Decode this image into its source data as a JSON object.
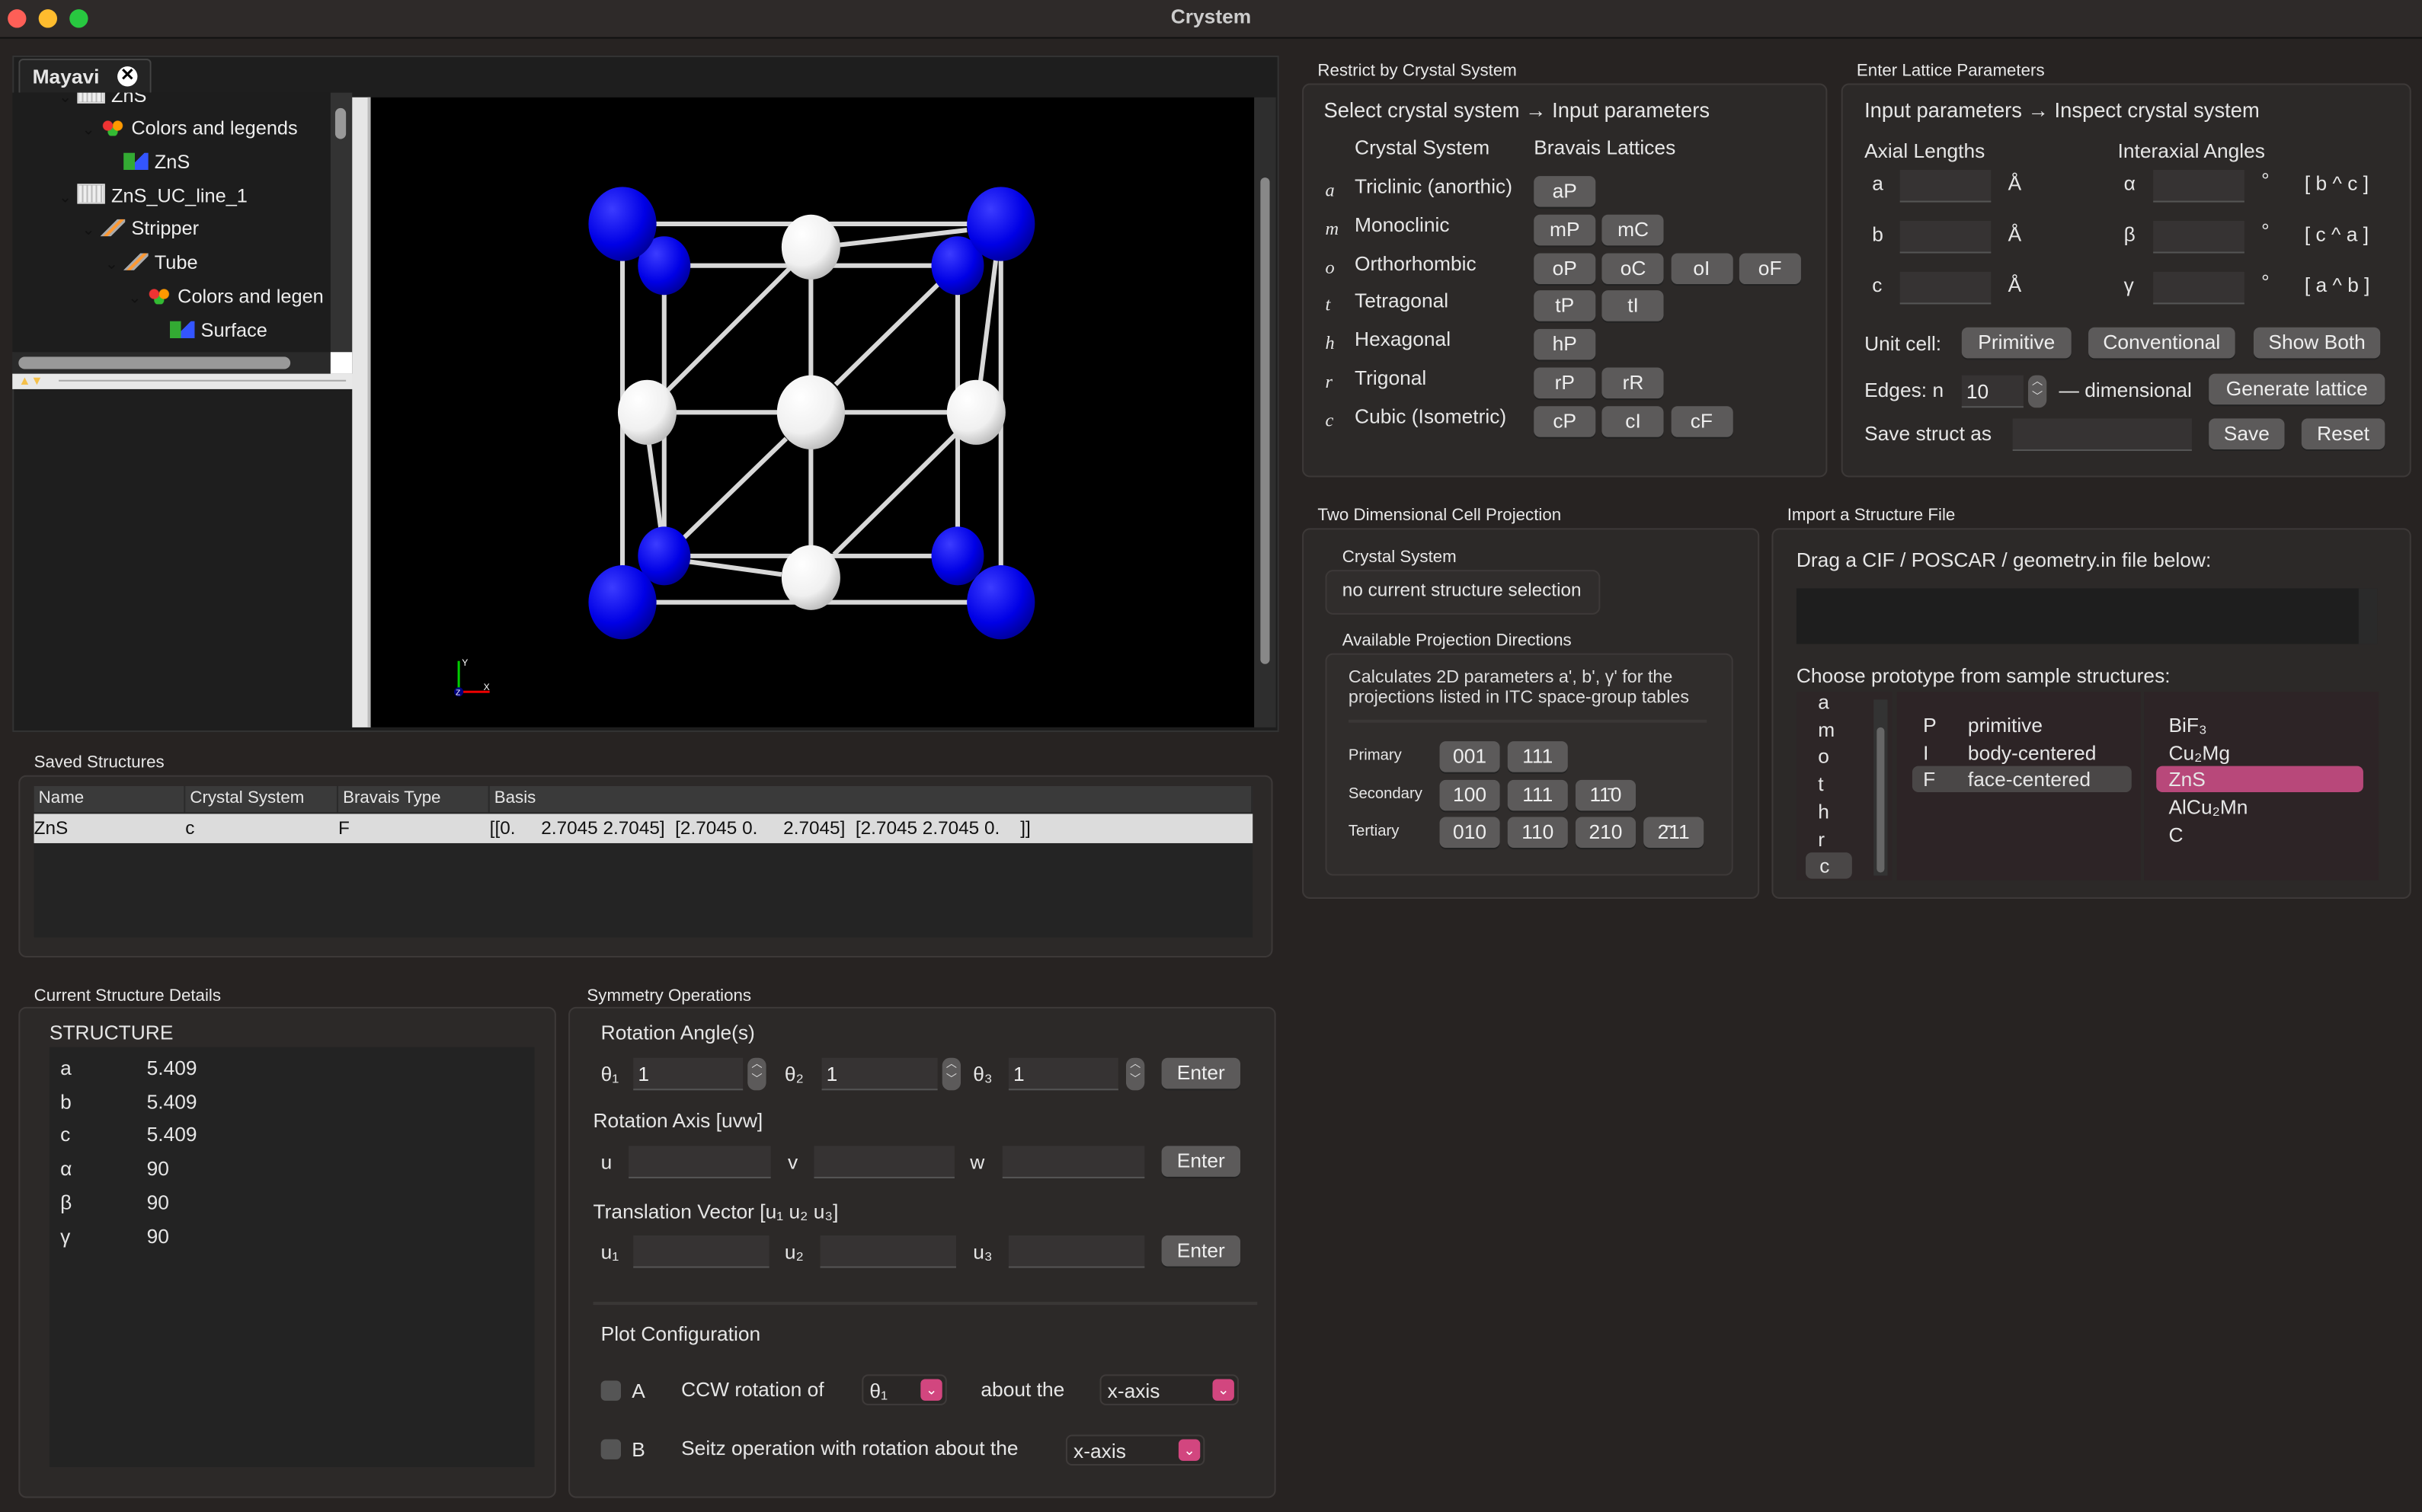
{
  "window": {
    "title": "Crystem"
  },
  "mayavi": {
    "tab_label": "Mayavi",
    "tree": [
      {
        "label": "ZnS",
        "icon": "grid-icon"
      },
      {
        "label": "Colors and legends",
        "icon": "colors-icon"
      },
      {
        "label": "ZnS",
        "icon": "surface-icon"
      },
      {
        "label": "ZnS_UC_line_1",
        "icon": "grid-icon"
      },
      {
        "label": "Stripper",
        "icon": "filter-icon"
      },
      {
        "label": "Tube",
        "icon": "filter-icon"
      },
      {
        "label": "Colors and legen",
        "icon": "colors-icon"
      },
      {
        "label": "Surface",
        "icon": "surface-icon"
      }
    ],
    "axes": {
      "x": "X",
      "y": "Y",
      "z": "Z"
    },
    "colors": {
      "zn": "#0000e6",
      "s": "#f0f0f0",
      "background": "#000000"
    }
  },
  "saved": {
    "title": "Saved Structures",
    "columns": [
      "Name",
      "Crystal System",
      "Bravais Type",
      "Basis"
    ],
    "rows": [
      [
        "ZnS",
        "c",
        "F",
        "[[0.     2.7045 2.7045]  [2.7045 0.     2.7045]  [2.7045 2.7045 0.    ]]"
      ]
    ]
  },
  "details": {
    "title": "Current Structure Details",
    "header": "STRUCTURE",
    "rows": [
      [
        "a",
        "5.409"
      ],
      [
        "b",
        "5.409"
      ],
      [
        "c",
        "5.409"
      ],
      [
        "α",
        "90"
      ],
      [
        "β",
        "90"
      ],
      [
        "γ",
        "90"
      ]
    ]
  },
  "symmetry": {
    "title": "Symmetry Operations",
    "rotation_title": "Rotation Angle(s)",
    "angles": [
      {
        "label": "θ₁",
        "value": "1"
      },
      {
        "label": "θ₂",
        "value": "1"
      },
      {
        "label": "θ₃",
        "value": "1"
      }
    ],
    "axis_title": "Rotation Axis [uvw]",
    "axis_labels": [
      "u",
      "v",
      "w"
    ],
    "translation_title": "Translation Vector [u₁ u₂ u₃]",
    "translation_labels": [
      "u₁",
      "u₂",
      "u₃"
    ],
    "enter_label": "Enter",
    "plot_title": "Plot Configuration",
    "option_a": {
      "letter": "A",
      "text": "CCW rotation of",
      "angle": "θ₁",
      "about": "about the",
      "axis": "x-axis",
      "checked": false
    },
    "option_b": {
      "letter": "B",
      "text": "Seitz operation with rotation about the",
      "axis": "x-axis",
      "checked": false
    }
  },
  "restrict": {
    "title": "Restrict by Crystal System",
    "subtitle": "Select crystal system → Input parameters",
    "col_system": "Crystal System",
    "col_lattices": "Bravais Lattices",
    "systems": [
      {
        "symbol": "a",
        "name": "Triclinic (anorthic)",
        "lattices": [
          "aP"
        ]
      },
      {
        "symbol": "m",
        "name": "Monoclinic",
        "lattices": [
          "mP",
          "mC"
        ]
      },
      {
        "symbol": "o",
        "name": "Orthorhombic",
        "lattices": [
          "oP",
          "oC",
          "oI",
          "oF"
        ]
      },
      {
        "symbol": "t",
        "name": "Tetragonal",
        "lattices": [
          "tP",
          "tI"
        ]
      },
      {
        "symbol": "h",
        "name": "Hexagonal",
        "lattices": [
          "hP"
        ]
      },
      {
        "symbol": "r",
        "name": "Trigonal",
        "lattices": [
          "rP",
          "rR"
        ]
      },
      {
        "symbol": "c",
        "name": "Cubic (Isometric)",
        "lattices": [
          "cP",
          "cI",
          "cF"
        ]
      }
    ]
  },
  "lattice": {
    "title": "Enter Lattice Parameters",
    "subtitle": "Input parameters → Inspect crystal system",
    "axial_title": "Axial Lengths",
    "angles_title": "Interaxial Angles",
    "rows": [
      {
        "len": "a",
        "unit": "Å",
        "ang": "α",
        "deg": "°",
        "pair": "[ b ^ c ]"
      },
      {
        "len": "b",
        "unit": "Å",
        "ang": "β",
        "deg": "°",
        "pair": "[ c ^ a ]"
      },
      {
        "len": "c",
        "unit": "Å",
        "ang": "γ",
        "deg": "°",
        "pair": "[ a ^ b ]"
      }
    ],
    "unit_cell_label": "Unit cell:",
    "primitive": "Primitive",
    "conventional": "Conventional",
    "show_both": "Show Both",
    "edges_label": "Edges: n",
    "edges_value": "10",
    "dimensional": "— dimensional",
    "generate": "Generate lattice",
    "save_label": "Save struct as",
    "save": "Save",
    "reset": "Reset"
  },
  "projection": {
    "title": "Two Dimensional Cell Projection",
    "system_label": "Crystal System",
    "system_value": "no current structure selection",
    "directions_label": "Available Projection Directions",
    "description": [
      "Calculates 2D parameters a', b', γ' for the",
      "projections listed in ITC space-group tables"
    ],
    "rows": [
      {
        "label": "Primary",
        "dirs": [
          "001",
          "111"
        ]
      },
      {
        "label": "Secondary",
        "dirs": [
          "100",
          "111",
          "11̄0"
        ]
      },
      {
        "label": "Tertiary",
        "dirs": [
          "010",
          "110",
          "210",
          "2̄11"
        ]
      }
    ]
  },
  "import": {
    "title": "Import a Structure File",
    "drag_label": "Drag a CIF / POSCAR / geometry.in file below:",
    "prototype_label": "Choose prototype from sample structures:",
    "systems": [
      "a",
      "m",
      "o",
      "t",
      "h",
      "r",
      "c"
    ],
    "selected_system": "c",
    "centering": [
      {
        "code": "P",
        "name": "primitive"
      },
      {
        "code": "I",
        "name": "body-centered"
      },
      {
        "code": "F",
        "name": "face-centered"
      }
    ],
    "selected_centering": "F",
    "prototypes": [
      "BiF₃",
      "Cu₂Mg",
      "ZnS",
      "AlCu₂Mn",
      "C"
    ],
    "selected_prototype": "ZnS",
    "accent": "#b8487a"
  }
}
